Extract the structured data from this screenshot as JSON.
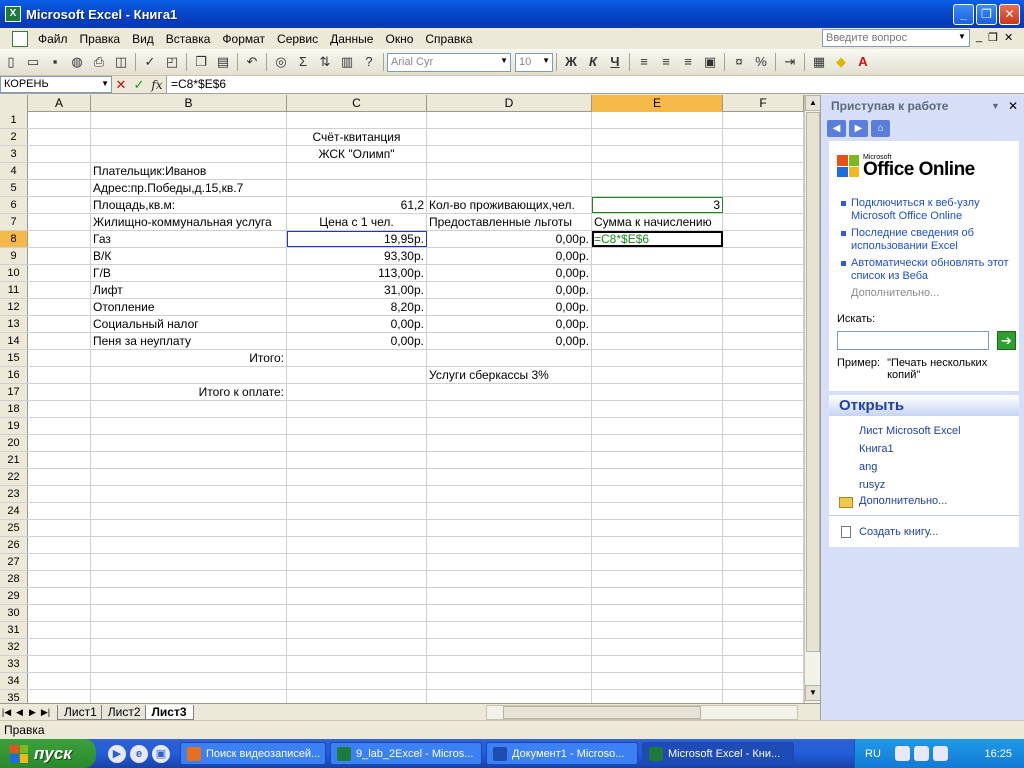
{
  "window": {
    "title": "Microsoft Excel - Книга1",
    "buttons": [
      "_",
      "❐",
      "✕"
    ]
  },
  "menu": {
    "items": [
      "Файл",
      "Правка",
      "Вид",
      "Вставка",
      "Формат",
      "Сервис",
      "Данные",
      "Окно",
      "Справка"
    ],
    "help_placeholder": "Введите вопрос"
  },
  "toolbar": {
    "font_name": "Arial Cyr",
    "font_size": "10",
    "sum_symbol": "Σ",
    "bold": "Ж",
    "italic": "К",
    "underline": "Ч",
    "percent": "%"
  },
  "formula_bar": {
    "name_box": "КОРЕНЬ",
    "cancel": "✕",
    "enter": "✓",
    "fx": "fx",
    "formula": "=C8*$E$6"
  },
  "columns": [
    "A",
    "B",
    "C",
    "D",
    "E",
    "F"
  ],
  "active_column": "E",
  "active_row": "8",
  "rows": [
    {
      "n": "1",
      "a": "",
      "b": "",
      "c": "",
      "d": "",
      "e": "",
      "f": ""
    },
    {
      "n": "2",
      "a": "",
      "b": "",
      "c": "Счёт-квитанция",
      "d": "",
      "e": "",
      "f": ""
    },
    {
      "n": "3",
      "a": "",
      "b": "",
      "c": "ЖСК \"Олимп\"",
      "d": "",
      "e": "",
      "f": ""
    },
    {
      "n": "4",
      "a": "",
      "b": "Плательщик:Иванов",
      "c": "",
      "d": "",
      "e": "",
      "f": ""
    },
    {
      "n": "5",
      "a": "",
      "b": "Адрес:пр.Победы,д.15,кв.7",
      "c": "",
      "d": "",
      "e": "",
      "f": ""
    },
    {
      "n": "6",
      "a": "",
      "b": "Площадь,кв.м:",
      "c": "61,2",
      "d": "Кол-во проживающих,чел.",
      "e": "3",
      "f": ""
    },
    {
      "n": "7",
      "a": "",
      "b": "Жилищно-коммунальная услуга",
      "c": "Цена с 1 чел.",
      "d": "Предоставленные льготы",
      "e": "Сумма к начислению",
      "f": ""
    },
    {
      "n": "8",
      "a": "",
      "b": "Газ",
      "c": "19,95р.",
      "d": "0,00р.",
      "e": "=C8*$E$6",
      "f": ""
    },
    {
      "n": "9",
      "a": "",
      "b": "В/К",
      "c": "93,30р.",
      "d": "0,00р.",
      "e": "",
      "f": ""
    },
    {
      "n": "10",
      "a": "",
      "b": "Г/В",
      "c": "113,00р.",
      "d": "0,00р.",
      "e": "",
      "f": ""
    },
    {
      "n": "11",
      "a": "",
      "b": "Лифт",
      "c": "31,00р.",
      "d": "0,00р.",
      "e": "",
      "f": ""
    },
    {
      "n": "12",
      "a": "",
      "b": "Отопление",
      "c": "8,20р.",
      "d": "0,00р.",
      "e": "",
      "f": ""
    },
    {
      "n": "13",
      "a": "",
      "b": "Социальный налог",
      "c": "0,00р.",
      "d": "0,00р.",
      "e": "",
      "f": ""
    },
    {
      "n": "14",
      "a": "",
      "b": "Пеня за неуплату",
      "c": "0,00р.",
      "d": "0,00р.",
      "e": "",
      "f": ""
    },
    {
      "n": "15",
      "a": "",
      "b": "Итого:",
      "c": "",
      "d": "",
      "e": "",
      "f": ""
    },
    {
      "n": "16",
      "a": "",
      "b": "",
      "c": "",
      "d": "Услуги сберкассы 3%",
      "e": "",
      "f": ""
    },
    {
      "n": "17",
      "a": "",
      "b": "Итого к оплате:",
      "c": "",
      "d": "",
      "e": "",
      "f": ""
    },
    {
      "n": "18"
    },
    {
      "n": "19"
    },
    {
      "n": "20"
    },
    {
      "n": "21"
    },
    {
      "n": "22"
    },
    {
      "n": "23"
    },
    {
      "n": "24"
    },
    {
      "n": "25"
    },
    {
      "n": "26"
    },
    {
      "n": "27"
    },
    {
      "n": "28"
    },
    {
      "n": "29"
    },
    {
      "n": "30"
    },
    {
      "n": "31"
    },
    {
      "n": "32"
    },
    {
      "n": "33"
    },
    {
      "n": "34"
    },
    {
      "n": "35"
    }
  ],
  "sheet_tabs": [
    "Лист1",
    "Лист2",
    "Лист3"
  ],
  "active_sheet": "Лист3",
  "status": "Правка",
  "task_pane": {
    "title": "Приступая к работе",
    "logo_small": "Microsoft",
    "logo": "Office Online",
    "links": [
      "Подключиться к веб-узлу Microsoft Office Online",
      "Последние сведения об использовании Excel",
      "Автоматически обновлять этот список из Веба"
    ],
    "more": "Дополнительно...",
    "search_label": "Искать:",
    "example_label": "Пример:",
    "example_text": "\"Печать нескольких копий\"",
    "open_header": "Открыть",
    "recent_files": [
      "Лист Microsoft Excel",
      "Книга1",
      "ang",
      "rusyz"
    ],
    "open_more": "Дополнительно...",
    "create": "Создать книгу..."
  },
  "taskbar": {
    "start": "пуск",
    "tasks": [
      "Поиск видеозаписей...",
      "9_lab_2Excel - Micros...",
      "Документ1 - Microso...",
      "Microsoft Excel - Кни..."
    ],
    "active_task": "Microsoft Excel - Кни...",
    "lang": "RU",
    "clock": "16:25"
  }
}
